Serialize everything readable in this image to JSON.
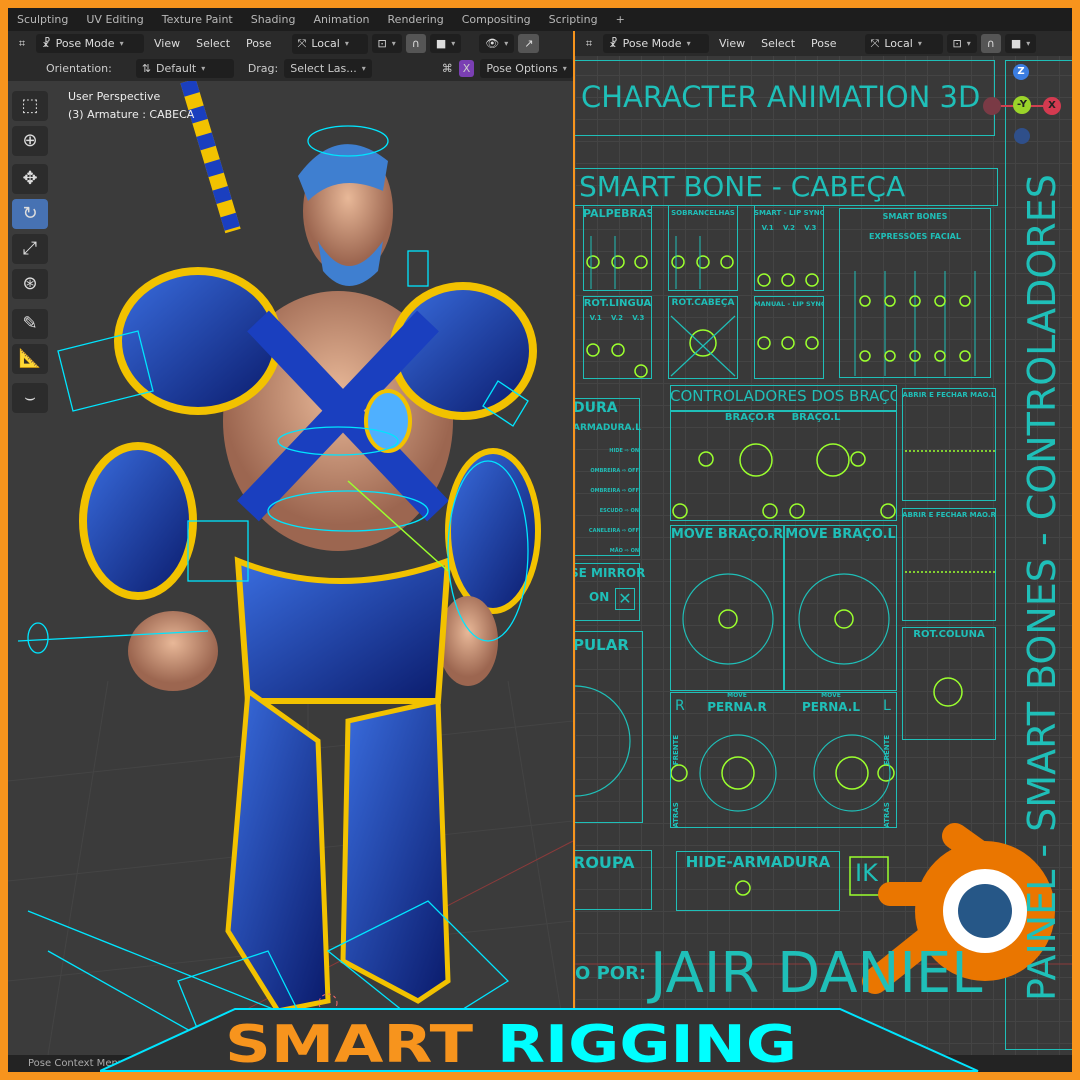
{
  "workspace_tabs": [
    "Sculpting",
    "UV Editing",
    "Texture Paint",
    "Shading",
    "Animation",
    "Rendering",
    "Compositing",
    "Scripting",
    "+"
  ],
  "left_viewport": {
    "header": {
      "mode": "Pose Mode",
      "menus": [
        "View",
        "Select",
        "Pose"
      ],
      "transform": "Local"
    },
    "tool_settings": {
      "orientation_label": "Orientation:",
      "orientation_value": "Default",
      "drag_label": "Drag:",
      "drag_value": "Select Las...",
      "x_mirror": "X",
      "pose_options": "Pose Options"
    },
    "overlay": {
      "view": "User Perspective",
      "object": "(3) Armature : CABECA"
    },
    "tools": [
      "select-box-icon",
      "cursor-icon",
      "move-icon",
      "rotate-icon",
      "scale-icon",
      "transform-icon",
      "annotate-icon",
      "measure-icon",
      "relax-pose-icon"
    ]
  },
  "right_viewport": {
    "header": {
      "mode": "Pose Mode",
      "menus": [
        "View",
        "Select",
        "Pose"
      ],
      "transform": "Local"
    },
    "gizmo": {
      "z": "Z",
      "y": "-Y",
      "x": "X"
    },
    "panel": {
      "title": "CHARACTER ANIMATION 3D",
      "vertical_title": "PAINEL - SMART BONES - CONTROLADORES",
      "head_section": "SMART BONE - CABEÇA",
      "palpebras": "PALPEBRAS",
      "sobrancelhas": "SOBRANCELHAS",
      "smart_lip_sync": "SMART - LIP SYNC",
      "lip_cols": [
        "V.1",
        "V.2",
        "V.3"
      ],
      "smart_bones": "SMART BONES",
      "expressoes": "EXPRESSÕES FACIAL",
      "rot_lingua": "ROT.LINGUA",
      "rot_lingua_cols": [
        "V.1",
        "V.2",
        "V.3"
      ],
      "rot_cabeca": "ROT.CABEÇA",
      "manual_lip_sync": "MANUAL - LIP SYNC",
      "bracos_title": "CONTROLADORES DOS BRAÇOS",
      "braco_r": "BRAÇO.R",
      "braco_l": "BRAÇO.L",
      "move_braco_r": "MOVE BRAÇO.R",
      "move_braco_l": "MOVE BRAÇO.L",
      "mao_l": "ABRIR E FECHAR MÃO.L",
      "mao_r": "ABRIR E FECHAR MÃO.R",
      "rot_coluna": "ROT.COLUNA",
      "armadura": "DURA",
      "armadura_l": "ARMADURA.L",
      "armadura_toggles": [
        "HIDE ⇨ ON",
        "OMBREIRA ⇨ OFF",
        "OMBREIRA ⇨ OFF",
        "ESCUDO ⇨ ON",
        "CANELEIRA ⇨ OFF",
        "MÃO ⇨ ON"
      ],
      "mirror": "SE MIRROR",
      "mirror_on": "ON",
      "pular": "PULAR",
      "move": "MOVE",
      "perna_r": "PERNA.R",
      "perna_l": "PERNA.L",
      "side_r": "R",
      "side_l": "L",
      "frente": "FRENTE",
      "atras": "ATRÁS",
      "roupa": "ROUPA",
      "hide_armadura": "HIDE-ARMADURA",
      "ik": "IK",
      "credit_label": "O POR:",
      "credit_name": "JAIR DANIEL"
    }
  },
  "status_bar": {
    "text": "Pose Context Menu"
  },
  "banner": {
    "word1": "SMART",
    "word2": "RIGGING",
    "color1": "#f7941d",
    "color2": "#00ffff"
  },
  "colors": {
    "frame": "#f7941d",
    "bone": "#00e5ff",
    "panel_line": "#1fbfb8",
    "control": "#9bff2e",
    "blender_orange": "#ea7600",
    "blender_blue": "#265787"
  }
}
